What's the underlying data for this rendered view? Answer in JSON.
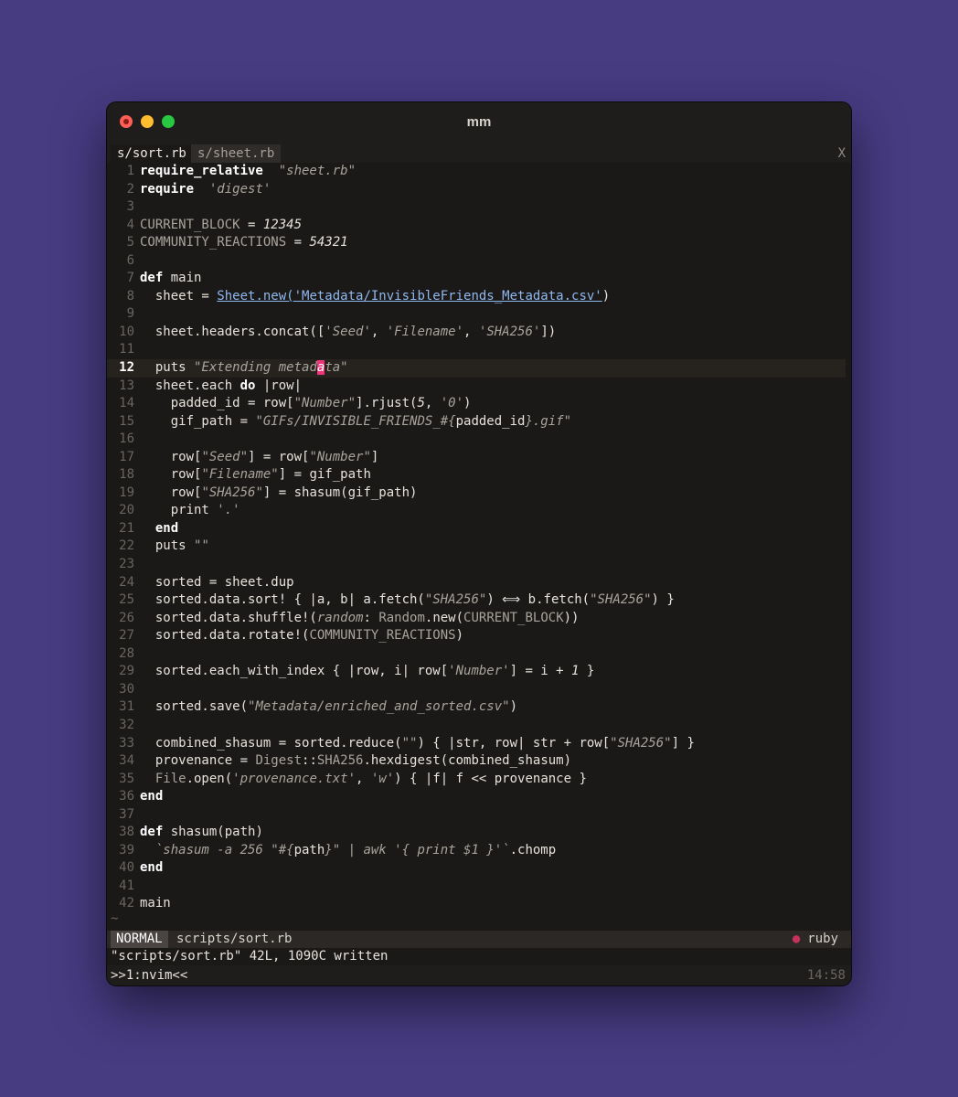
{
  "window": {
    "title": "mm"
  },
  "tabs": [
    {
      "label": "s/sort.rb",
      "active": true
    },
    {
      "label": "s/sheet.rb",
      "active": false
    }
  ],
  "tab_close_label": "X",
  "current_line": 12,
  "lines": [
    {
      "n": "1",
      "segs": [
        [
          "kw",
          "require_relative"
        ],
        [
          "",
          "  "
        ],
        [
          "str",
          "\"sheet.rb\""
        ]
      ]
    },
    {
      "n": "2",
      "segs": [
        [
          "kw",
          "require"
        ],
        [
          "",
          "  "
        ],
        [
          "str",
          "'digest'"
        ]
      ]
    },
    {
      "n": "3",
      "segs": []
    },
    {
      "n": "4",
      "segs": [
        [
          "const",
          "CURRENT_BLOCK"
        ],
        [
          "",
          " = "
        ],
        [
          "num",
          "12345"
        ]
      ]
    },
    {
      "n": "5",
      "segs": [
        [
          "const",
          "COMMUNITY_REACTIONS"
        ],
        [
          "",
          " = "
        ],
        [
          "num",
          "54321"
        ]
      ]
    },
    {
      "n": "6",
      "segs": []
    },
    {
      "n": "7",
      "segs": [
        [
          "kw",
          "def"
        ],
        [
          "",
          " main"
        ]
      ]
    },
    {
      "n": "8",
      "segs": [
        [
          "",
          "  sheet = "
        ],
        [
          "link",
          "Sheet.new('Metadata/InvisibleFriends_Metadata.csv'"
        ],
        [
          "",
          ")"
        ]
      ]
    },
    {
      "n": "9",
      "segs": []
    },
    {
      "n": "10",
      "segs": [
        [
          "",
          "  sheet.headers.concat(["
        ],
        [
          "str",
          "'Seed'"
        ],
        [
          "",
          ", "
        ],
        [
          "str",
          "'Filename'"
        ],
        [
          "",
          ", "
        ],
        [
          "str",
          "'SHA256'"
        ],
        [
          "",
          "])"
        ]
      ]
    },
    {
      "n": "11",
      "segs": []
    },
    {
      "n": "12",
      "segs": [
        [
          "",
          "  puts "
        ],
        [
          "str",
          "\"Extending metad"
        ],
        [
          "cursor",
          "a"
        ],
        [
          "str",
          "ta\""
        ]
      ]
    },
    {
      "n": "13",
      "segs": [
        [
          "",
          "  sheet.each "
        ],
        [
          "kw",
          "do"
        ],
        [
          "",
          " |row|"
        ]
      ]
    },
    {
      "n": "14",
      "segs": [
        [
          "",
          "    padded_id = row["
        ],
        [
          "str",
          "\"Number\""
        ],
        [
          "",
          "].rjust("
        ],
        [
          "num",
          "5"
        ],
        [
          "",
          ", "
        ],
        [
          "str",
          "'0'"
        ],
        [
          "",
          ")"
        ]
      ]
    },
    {
      "n": "15",
      "segs": [
        [
          "",
          "    gif_path = "
        ],
        [
          "str",
          "\"GIFs/INVISIBLE_FRIENDS_#{"
        ],
        [
          "",
          "padded_id"
        ],
        [
          "str",
          "}.gif\""
        ]
      ]
    },
    {
      "n": "16",
      "segs": []
    },
    {
      "n": "17",
      "segs": [
        [
          "",
          "    row["
        ],
        [
          "str",
          "\"Seed\""
        ],
        [
          "",
          "] = row["
        ],
        [
          "str",
          "\"Number\""
        ],
        [
          "",
          "]"
        ]
      ]
    },
    {
      "n": "18",
      "segs": [
        [
          "",
          "    row["
        ],
        [
          "str",
          "\"Filename\""
        ],
        [
          "",
          "] = gif_path"
        ]
      ]
    },
    {
      "n": "19",
      "segs": [
        [
          "",
          "    row["
        ],
        [
          "str",
          "\"SHA256\""
        ],
        [
          "",
          "] = shasum(gif_path)"
        ]
      ]
    },
    {
      "n": "20",
      "segs": [
        [
          "",
          "    print "
        ],
        [
          "str",
          "'.'"
        ]
      ]
    },
    {
      "n": "21",
      "segs": [
        [
          "",
          "  "
        ],
        [
          "kw",
          "end"
        ]
      ]
    },
    {
      "n": "22",
      "segs": [
        [
          "",
          "  puts "
        ],
        [
          "str",
          "\"\""
        ]
      ]
    },
    {
      "n": "23",
      "segs": []
    },
    {
      "n": "24",
      "segs": [
        [
          "",
          "  sorted = sheet.dup"
        ]
      ]
    },
    {
      "n": "25",
      "segs": [
        [
          "",
          "  sorted.data.sort! { |a, b| a.fetch("
        ],
        [
          "str",
          "\"SHA256\""
        ],
        [
          "",
          ") ⟺ b.fetch("
        ],
        [
          "str",
          "\"SHA256\""
        ],
        [
          "",
          ") }"
        ]
      ]
    },
    {
      "n": "26",
      "segs": [
        [
          "",
          "  sorted.data.shuffle!("
        ],
        [
          "str",
          "random"
        ],
        [
          "",
          ": "
        ],
        [
          "const",
          "Random"
        ],
        [
          "",
          ".new("
        ],
        [
          "const",
          "CURRENT_BLOCK"
        ],
        [
          "",
          "))"
        ]
      ]
    },
    {
      "n": "27",
      "segs": [
        [
          "",
          "  sorted.data.rotate!("
        ],
        [
          "const",
          "COMMUNITY_REACTIONS"
        ],
        [
          "",
          ")"
        ]
      ]
    },
    {
      "n": "28",
      "segs": []
    },
    {
      "n": "29",
      "segs": [
        [
          "",
          "  sorted.each_with_index { |row, i| row["
        ],
        [
          "str",
          "'Number'"
        ],
        [
          "",
          "] = i + "
        ],
        [
          "num",
          "1"
        ],
        [
          "",
          " }"
        ]
      ]
    },
    {
      "n": "30",
      "segs": []
    },
    {
      "n": "31",
      "segs": [
        [
          "",
          "  sorted.save("
        ],
        [
          "str",
          "\"Metadata/enriched_and_sorted.csv\""
        ],
        [
          "",
          ")"
        ]
      ]
    },
    {
      "n": "32",
      "segs": []
    },
    {
      "n": "33",
      "segs": [
        [
          "",
          "  combined_shasum = sorted.reduce("
        ],
        [
          "str",
          "\"\""
        ],
        [
          "",
          ") { |str, row| str + row["
        ],
        [
          "str",
          "\"SHA256\""
        ],
        [
          "",
          "] }"
        ]
      ]
    },
    {
      "n": "34",
      "segs": [
        [
          "",
          "  provenance = "
        ],
        [
          "const",
          "Digest"
        ],
        [
          "",
          "::"
        ],
        [
          "const",
          "SHA256"
        ],
        [
          "",
          ".hexdigest(combined_shasum)"
        ]
      ]
    },
    {
      "n": "35",
      "segs": [
        [
          "",
          "  "
        ],
        [
          "const",
          "File"
        ],
        [
          "",
          ".open("
        ],
        [
          "str",
          "'provenance.txt'"
        ],
        [
          "",
          ", "
        ],
        [
          "str",
          "'w'"
        ],
        [
          "",
          ") { |f| f << provenance }"
        ]
      ]
    },
    {
      "n": "36",
      "segs": [
        [
          "kw",
          "end"
        ]
      ]
    },
    {
      "n": "37",
      "segs": []
    },
    {
      "n": "38",
      "segs": [
        [
          "kw",
          "def"
        ],
        [
          "",
          " shasum(path)"
        ]
      ]
    },
    {
      "n": "39",
      "segs": [
        [
          "",
          "  "
        ],
        [
          "str",
          "`shasum -a 256 \"#{"
        ],
        [
          "",
          "path"
        ],
        [
          "str",
          "}\" | awk '{ print $1 }'`"
        ],
        [
          "",
          ".chomp"
        ]
      ]
    },
    {
      "n": "40",
      "segs": [
        [
          "kw",
          "end"
        ]
      ]
    },
    {
      "n": "41",
      "segs": []
    },
    {
      "n": "42",
      "segs": [
        [
          "",
          "main"
        ]
      ]
    }
  ],
  "tilde": "~",
  "statusline": {
    "mode": "NORMAL",
    "file": "scripts/sort.rb",
    "filetype": "ruby",
    "filetype_icon": "●"
  },
  "message": "\"scripts/sort.rb\" 42L, 1090C written",
  "tmux": {
    "window": ">>1:nvim<<",
    "time": "14:58"
  },
  "colors": {
    "background": "#473b82",
    "editor": "#1b1918",
    "cursor": "#f2327a",
    "link": "#8fb8ee"
  }
}
